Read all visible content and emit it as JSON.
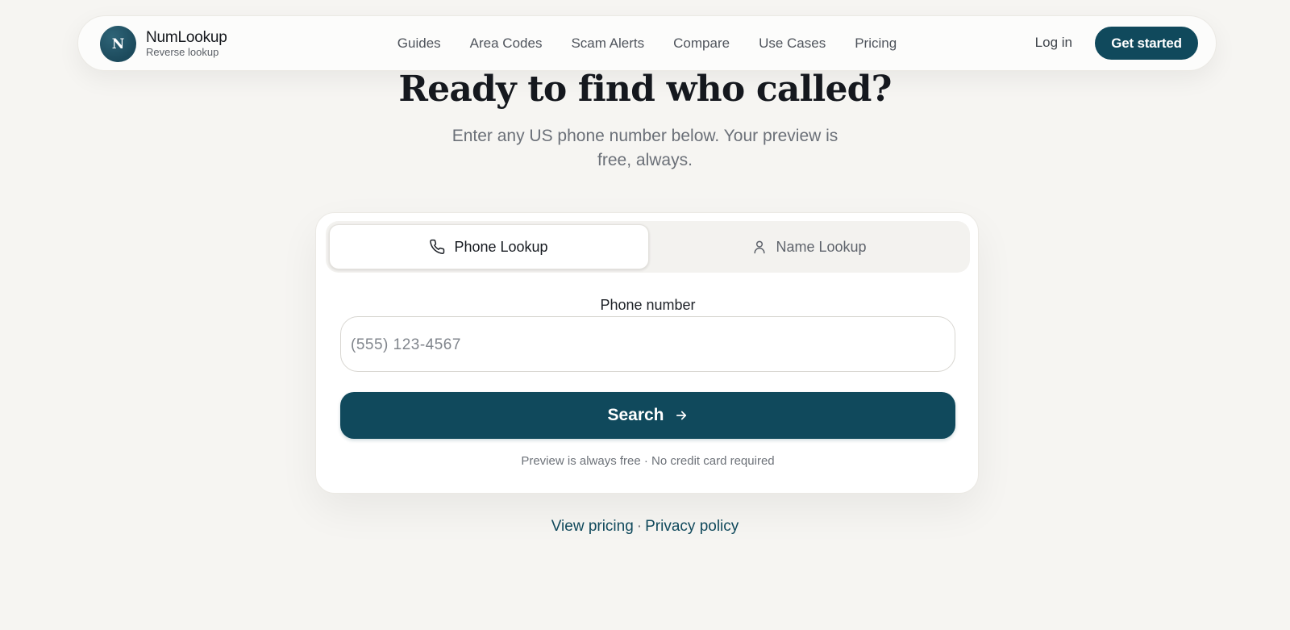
{
  "brand": {
    "logo_letter": "N",
    "name": "NumLookup",
    "tagline": "Reverse lookup"
  },
  "nav": {
    "links": [
      "Guides",
      "Area Codes",
      "Scam Alerts",
      "Compare",
      "Use Cases",
      "Pricing"
    ],
    "login_label": "Log in",
    "cta_label": "Get started"
  },
  "hero": {
    "title": "Ready to find who called?",
    "subtitle": "Enter any US phone number below. Your preview is free, always."
  },
  "search_card": {
    "tabs": [
      {
        "label": "Phone Lookup",
        "icon": "phone-icon",
        "active": true
      },
      {
        "label": "Name Lookup",
        "icon": "user-icon",
        "active": false
      }
    ],
    "field_label": "Phone number",
    "input_value": "",
    "input_placeholder": "(555) 123-4567",
    "search_label": "Search",
    "fine_print": "Preview is always free · No credit card required"
  },
  "footer": {
    "view_pricing": "View pricing",
    "separator": "·",
    "privacy_policy": "Privacy policy"
  },
  "colors": {
    "page_bg": "#f6f5f2",
    "primary": "#10495c",
    "text": "#15181e",
    "muted": "#6b7078"
  }
}
